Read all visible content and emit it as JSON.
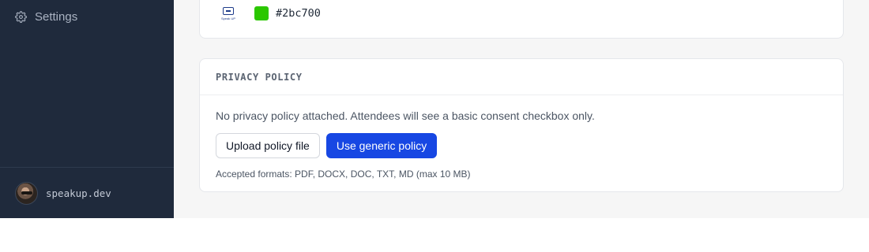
{
  "sidebar": {
    "items": [
      {
        "label": "Settings",
        "icon": "gear-icon"
      }
    ],
    "footer": {
      "user": "speakup.dev"
    }
  },
  "branding": {
    "logo_wordmark": "Speak UP",
    "brand_color": "#2bc700",
    "brand_color_label": "#2bc700"
  },
  "privacy_policy": {
    "title": "PRIVACY POLICY",
    "status_text": "No privacy policy attached. Attendees will see a basic consent checkbox only.",
    "upload_label": "Upload policy file",
    "generic_label": "Use generic policy",
    "formats_text": "Accepted formats: PDF, DOCX, DOC, TXT, MD (max 10 MB)"
  },
  "colors": {
    "sidebar_bg": "#1f2a3c",
    "primary": "#1747e3",
    "page_bg": "#f6f6f6"
  }
}
